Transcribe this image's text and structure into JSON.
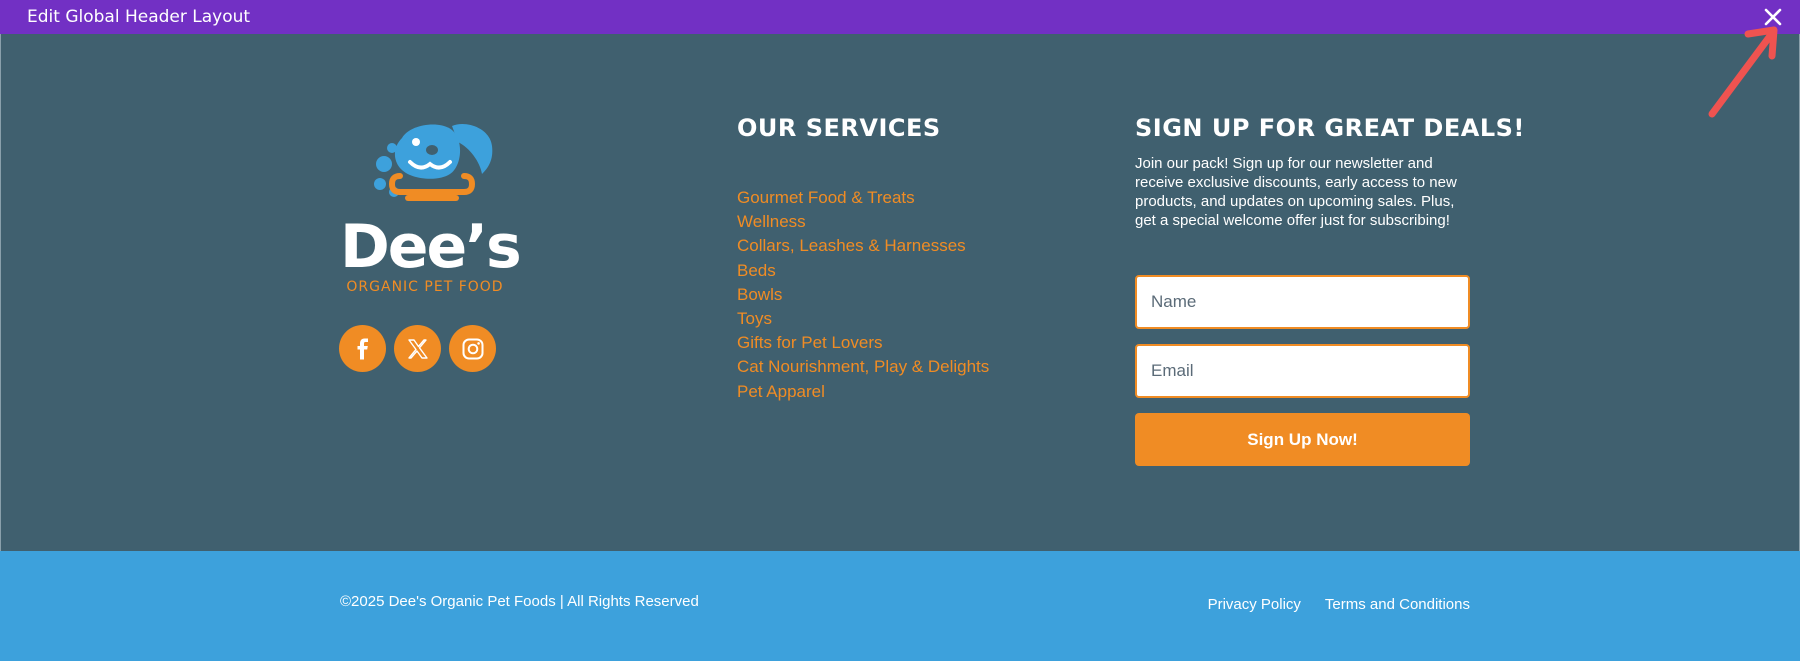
{
  "editor_bar": {
    "title": "Edit Global Header Layout",
    "close_icon": "close-icon",
    "background": "#7230c4"
  },
  "brand": {
    "wordmark": "Dee’s",
    "tagline": "ORGANIC PET FOOD",
    "logo_icon": "dog-face-bone-icon"
  },
  "socials": [
    {
      "name": "facebook",
      "icon": "facebook-icon"
    },
    {
      "name": "x",
      "icon": "x-icon"
    },
    {
      "name": "instagram",
      "icon": "instagram-icon"
    }
  ],
  "services": {
    "title": "Our Services",
    "items": [
      "Gourmet Food & Treats",
      "Wellness",
      "Collars, Leashes & Harnesses",
      "Beds",
      "Bowls",
      "Toys",
      "Gifts for Pet Lovers",
      "Cat Nourishment, Play & Delights",
      "Pet Apparel"
    ]
  },
  "signup": {
    "title": "Sign Up for Great Deals!",
    "description": "Join our pack! Sign up for our newsletter and receive exclusive discounts, early access to new products, and updates on upcoming sales. Plus, get a special welcome offer just for subscribing!",
    "name_placeholder": "Name",
    "email_placeholder": "Email",
    "button_label": "Sign Up Now!"
  },
  "bottom": {
    "copyright": "©2025 Dee's Organic Pet Foods | All Rights Reserved",
    "links": [
      "Privacy Policy",
      "Terms and Conditions"
    ]
  },
  "colors": {
    "footer_bg": "#40606f",
    "accent": "#f08c24",
    "bottom_bar": "#3da1dc",
    "annotation_arrow": "#ef5350"
  }
}
